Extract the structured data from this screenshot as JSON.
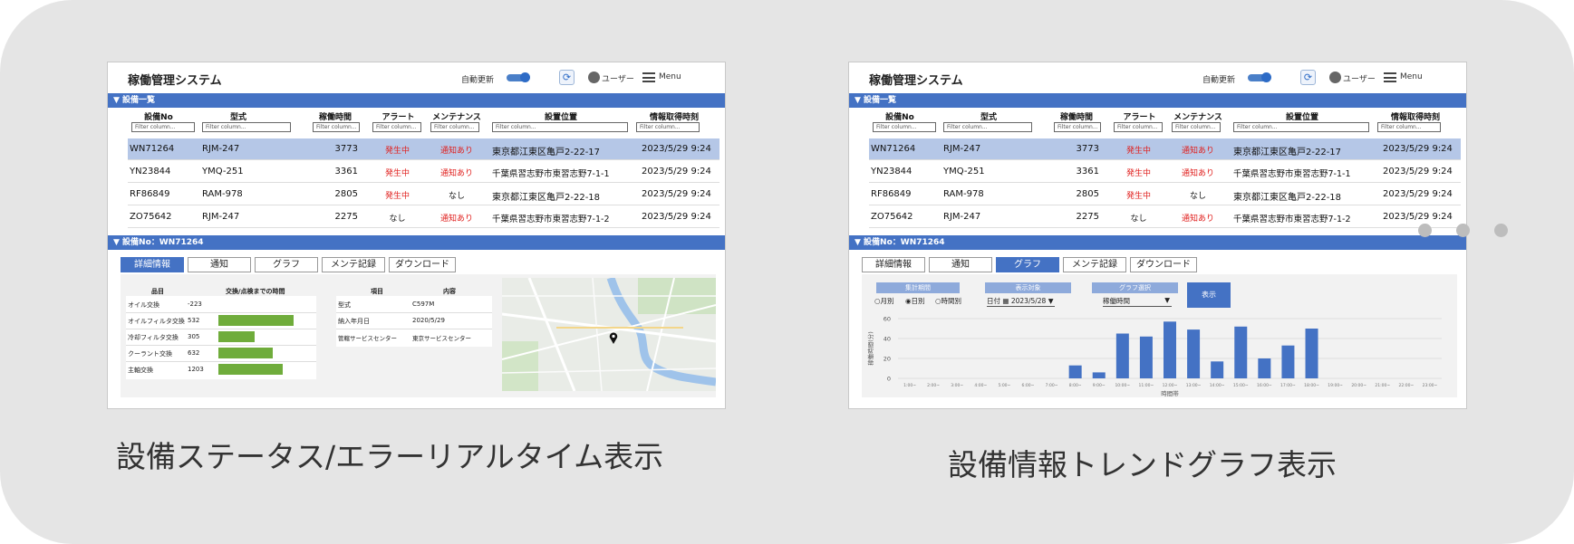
{
  "screenA": {
    "app_title": "稼働管理システム",
    "auto_update": "自動更新",
    "user": "ユーザー",
    "menu": "Menu",
    "list_section": "▼ 設備一覧",
    "columns": [
      "設備No",
      "型式",
      "稼働時間",
      "アラート",
      "メンテナンス",
      "設置位置",
      "情報取得時刻"
    ],
    "filter_placeholder": "Filter column...",
    "rows": [
      [
        "WN71264",
        "RJM-247",
        "3773",
        "発生中",
        "通知あり",
        "東京都江東区亀戸2-22-17",
        "2023/5/29 9:24"
      ],
      [
        "YN23844",
        "YMQ-251",
        "3361",
        "発生中",
        "通知あり",
        "千葉県習志野市東習志野7-1-1",
        "2023/5/29 9:24"
      ],
      [
        "RF86849",
        "RAM-978",
        "2805",
        "発生中",
        "なし",
        "東京都江東区亀戸2-22-18",
        "2023/5/29 9:24"
      ],
      [
        "ZO75642",
        "RJM-247",
        "2275",
        "なし",
        "通知あり",
        "千葉県習志野市東習志野7-1-2",
        "2023/5/29 9:24"
      ]
    ],
    "detail_section": "▼ 設備No：WN71264",
    "tabs": [
      "詳細情報",
      "通知",
      "グラフ",
      "メンテ記録",
      "ダウンロード"
    ],
    "parts_header": [
      "品目",
      "交換/点検までの時間"
    ],
    "parts": [
      {
        "name": "オイル交換",
        "value": "-223",
        "fill": 0
      },
      {
        "name": "オイルフィルタ交換",
        "value": "532",
        "fill": 0.55
      },
      {
        "name": "冷却フィルタ交換",
        "value": "305",
        "fill": 0.26
      },
      {
        "name": "クーラント交換",
        "value": "632",
        "fill": 0.4
      },
      {
        "name": "主軸交換",
        "value": "1203",
        "fill": 0.47
      }
    ],
    "info_header": [
      "項目",
      "内容"
    ],
    "info": [
      [
        "型式",
        "C597M"
      ],
      [
        "納入年月日",
        "2020/5/29"
      ],
      [
        "管轄サービスセンター",
        "東京サービスセンター"
      ]
    ],
    "map_pin_icon": "map-pin-icon"
  },
  "screenB": {
    "app_title": "稼働管理システム",
    "auto_update": "自動更新",
    "user": "ユーザー",
    "menu": "Menu",
    "list_section": "▼ 設備一覧",
    "columns": [
      "設備No",
      "型式",
      "稼働時間",
      "アラート",
      "メンテナンス",
      "設置位置",
      "情報取得時刻"
    ],
    "filter_placeholder": "Filter column...",
    "rows": [
      [
        "WN71264",
        "RJM-247",
        "3773",
        "発生中",
        "通知あり",
        "東京都江東区亀戸2-22-17",
        "2023/5/29 9:24"
      ],
      [
        "YN23844",
        "YMQ-251",
        "3361",
        "発生中",
        "通知あり",
        "千葉県習志野市東習志野7-1-1",
        "2023/5/29 9:24"
      ],
      [
        "RF86849",
        "RAM-978",
        "2805",
        "発生中",
        "なし",
        "東京都江東区亀戸2-22-18",
        "2023/5/29 9:24"
      ],
      [
        "ZO75642",
        "RJM-247",
        "2275",
        "なし",
        "通知あり",
        "千葉県習志野市東習志野7-1-2",
        "2023/5/29 9:24"
      ]
    ],
    "detail_section": "▼ 設備No：WN71264",
    "tabs": [
      "詳細情報",
      "通知",
      "グラフ",
      "メンテ記録",
      "ダウンロード"
    ],
    "controls": {
      "period_label": "集計期間",
      "period_options": [
        "○月別",
        "◉日別",
        "○時間別"
      ],
      "target_label": "表示対象",
      "target_value": "日付 ▦ 2023/5/28 ▼",
      "graph_label": "グラフ選択",
      "graph_value": "稼働時間",
      "show_button": "表示"
    }
  },
  "chart_data": {
    "type": "bar",
    "xlabel": "時間帯",
    "ylabel": "稼働時間(分)",
    "ylim": [
      0,
      60
    ],
    "yticks": [
      "0",
      "20",
      "40",
      "60"
    ],
    "categories": [
      "1:00~",
      "2:00~",
      "3:00~",
      "4:00~",
      "5:00~",
      "6:00~",
      "7:00~",
      "8:00~",
      "9:00~",
      "10:00~",
      "11:00~",
      "12:00~",
      "13:00~",
      "14:00~",
      "15:00~",
      "16:00~",
      "17:00~",
      "18:00~",
      "19:00~",
      "20:00~",
      "21:00~",
      "22:00~",
      "23:00~"
    ],
    "values": [
      0,
      0,
      0,
      0,
      0,
      0,
      0,
      13,
      6,
      45,
      42,
      57,
      49,
      17,
      52,
      20,
      33,
      50,
      0,
      0,
      0,
      0,
      0
    ],
    "color": "#4472c4"
  },
  "captions": {
    "left": "設備ステータス/エラーリアルタイム表示",
    "right": "設備情報トレンドグラフ表示"
  }
}
